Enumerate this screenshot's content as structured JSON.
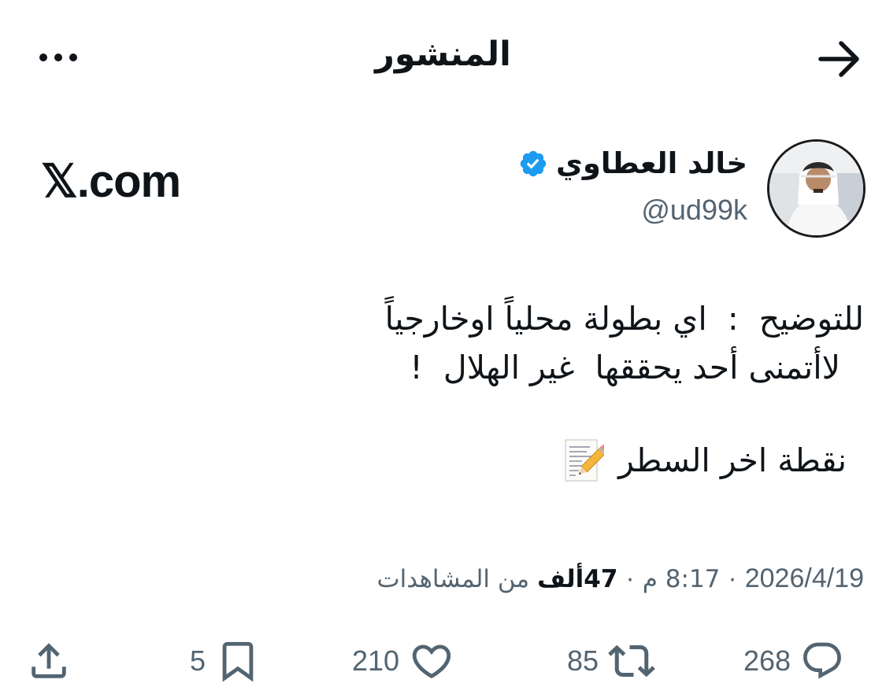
{
  "header": {
    "title": "المنشور",
    "back_icon": "arrow-right-icon",
    "more_icon": "more-dots-icon"
  },
  "author": {
    "name": "خالد العطاوي",
    "handle": "@ud99k",
    "verified_icon": "verified-badge-icon",
    "verified_color": "#1d9bf0"
  },
  "source": {
    "label": "𝕏.com"
  },
  "tweet": {
    "line1": "للتوضيح  :  اي بطولة محلياً اوخارجياً",
    "line2": "لاأتمنى أحد يحققها  غير الهلال  !",
    "line3": "نقطة اخر السطر",
    "emoji_icon": "memo-icon"
  },
  "meta": {
    "date": "2026/4/19",
    "separator": "·",
    "time": "8:17 م",
    "views_count": "47ألف",
    "views_label": "من المشاهدات"
  },
  "actions": {
    "replies": "268",
    "retweets": "85",
    "likes": "210",
    "bookmarks": "5"
  },
  "colors": {
    "text": "#0f1419",
    "secondary": "#536471",
    "accent": "#1d9bf0"
  }
}
